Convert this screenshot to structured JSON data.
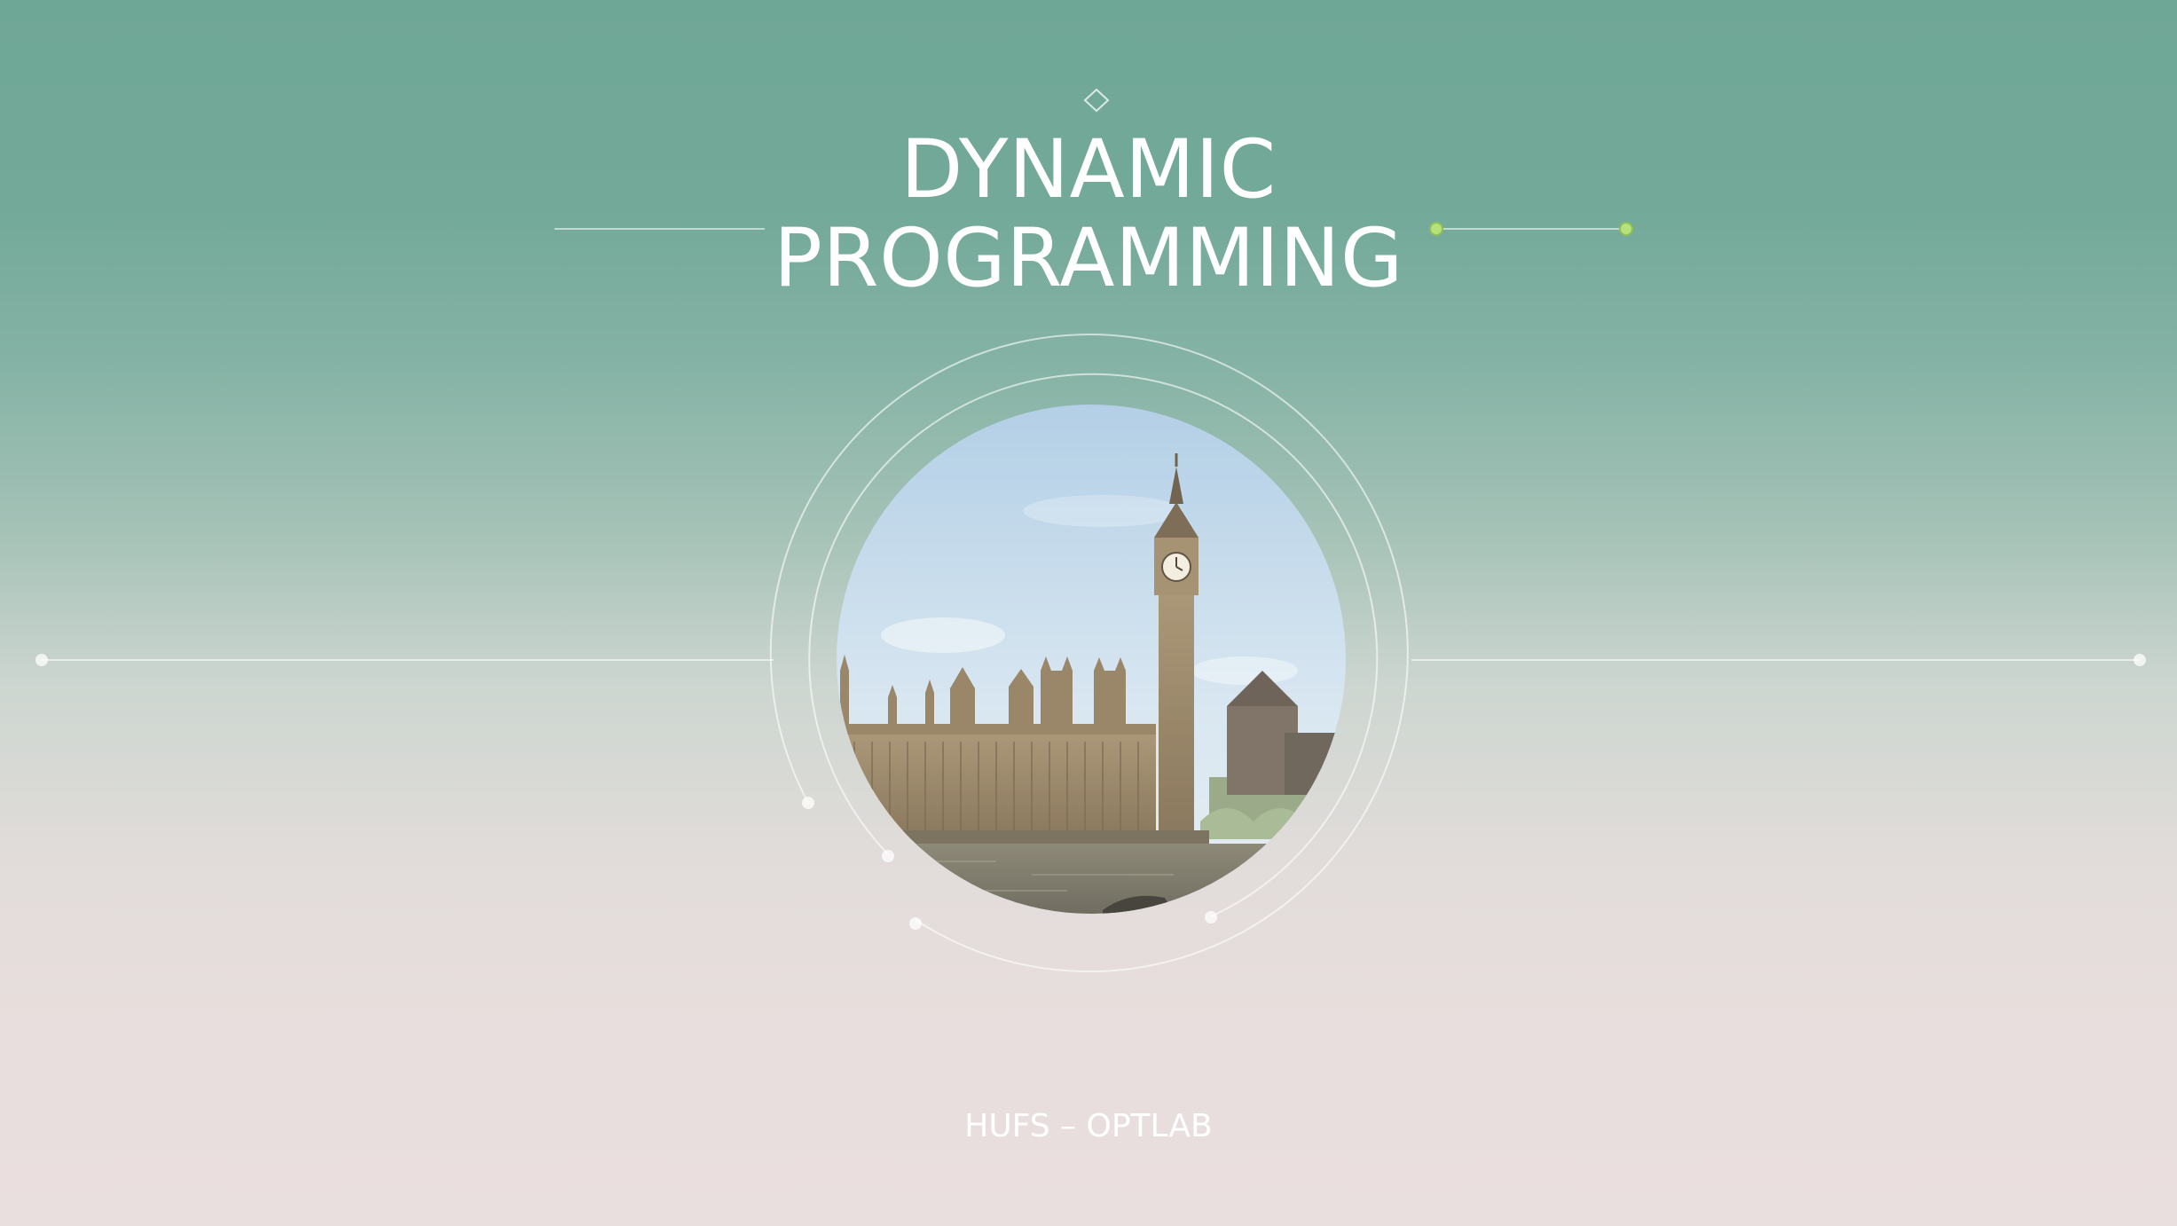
{
  "slide": {
    "title_line1": "DYNAMIC",
    "title_line2": "PROGRAMMING",
    "footer": "HUFS – OPTLAB"
  },
  "photo": {
    "subject": "Palace of Westminster with Big Ben clock tower over the River Thames",
    "icon": "landmark-photo"
  },
  "colors": {
    "top": "#6fa797",
    "bottom": "#eadfdf",
    "text": "#ffffff",
    "accent_dot": "#b5e27a"
  }
}
